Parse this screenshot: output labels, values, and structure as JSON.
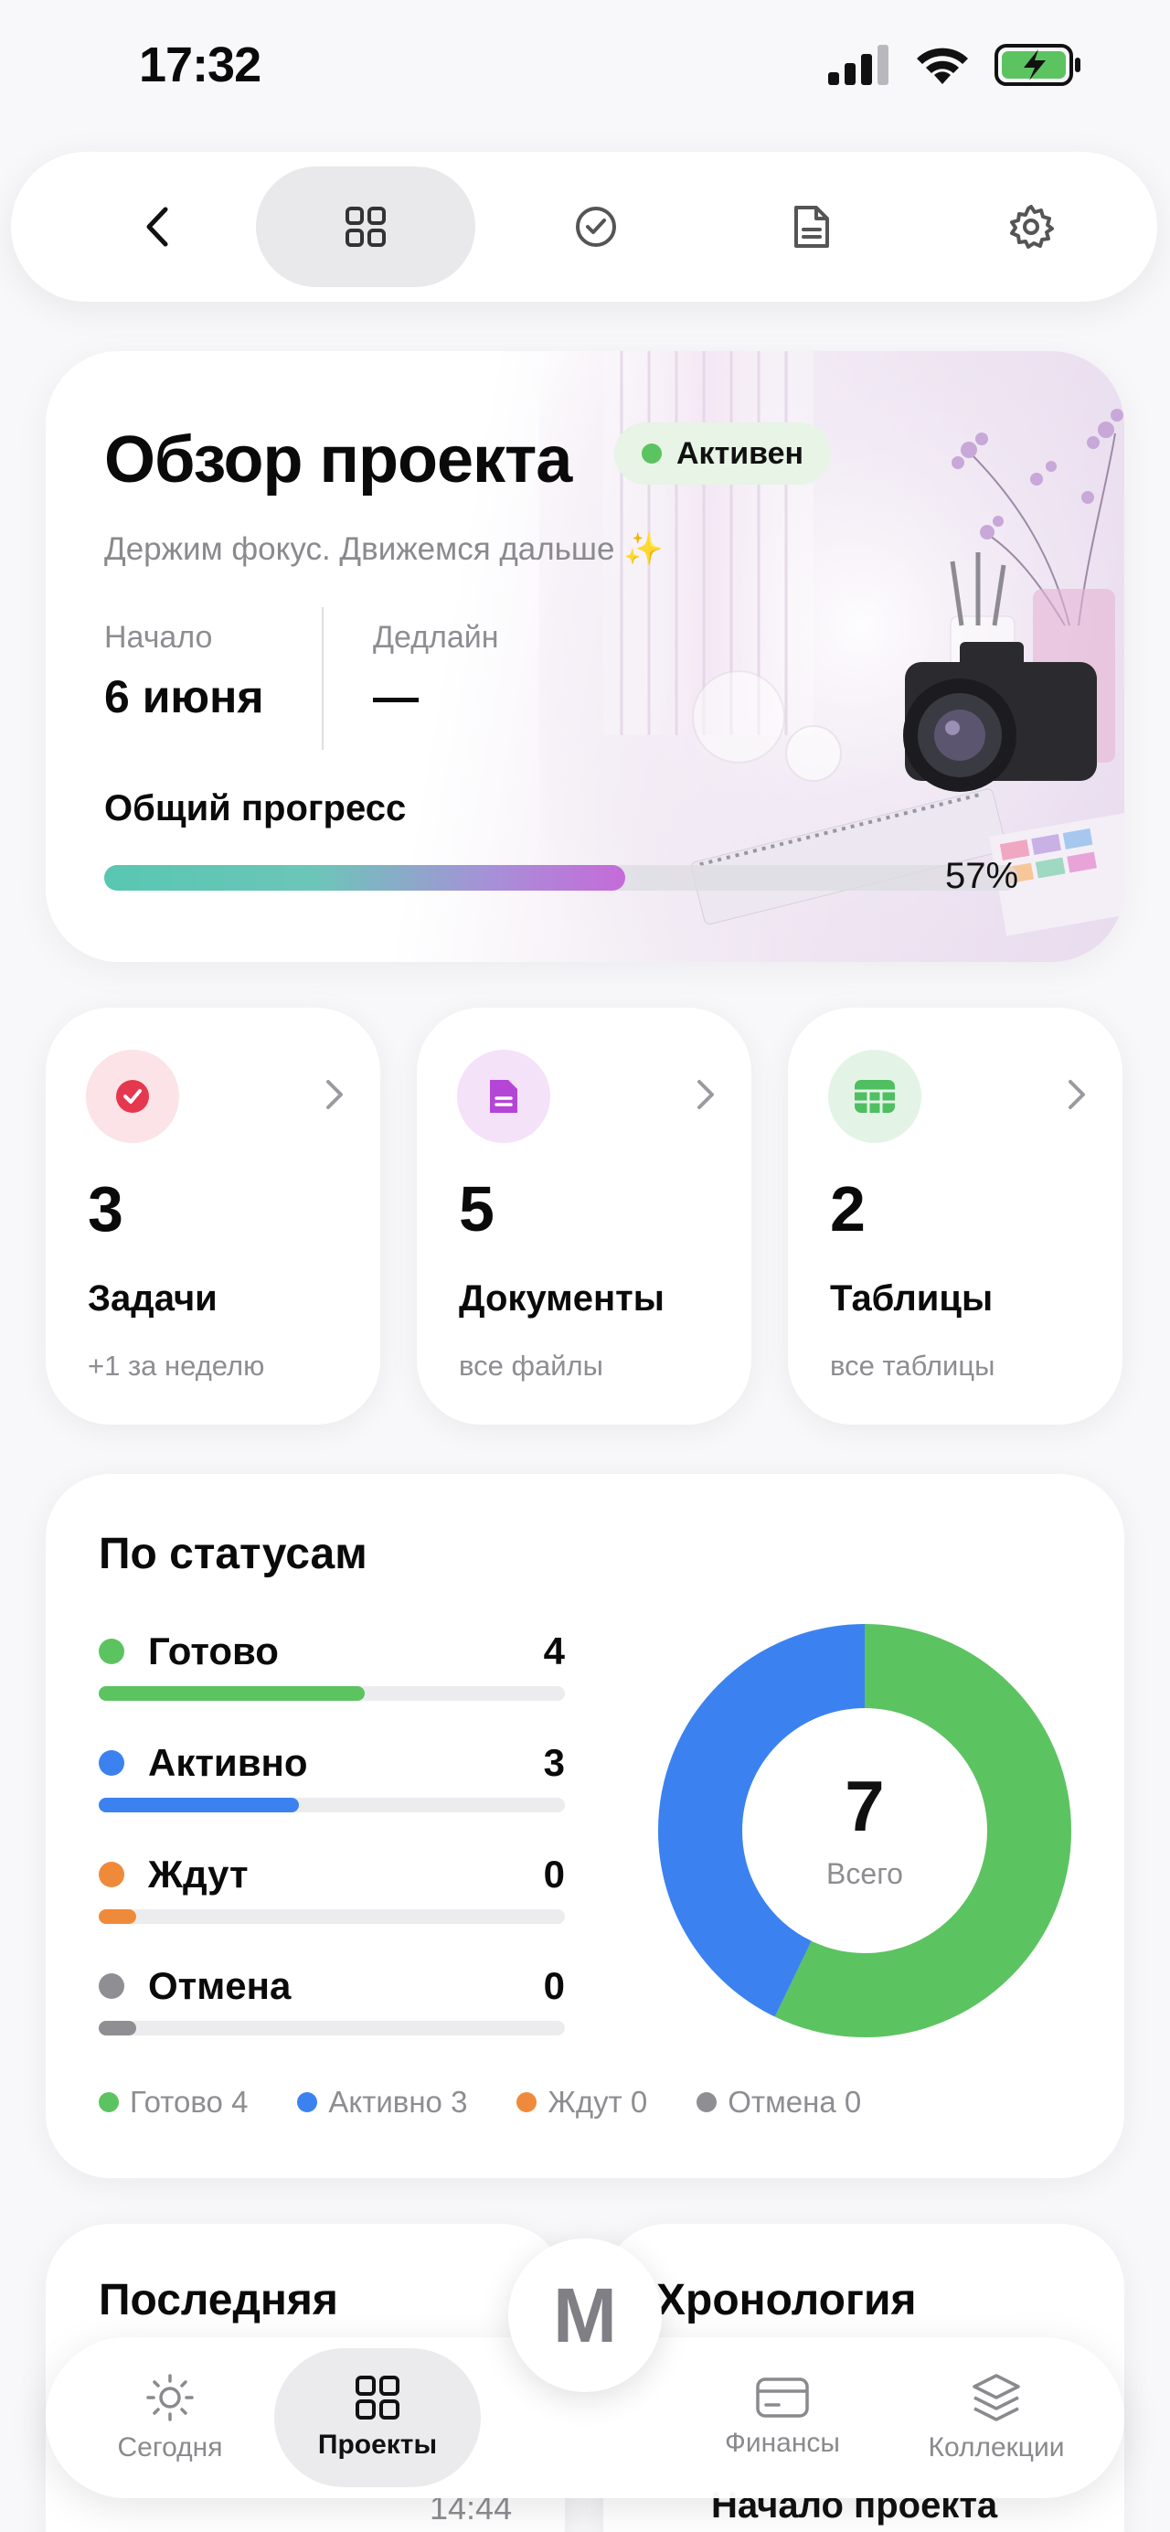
{
  "status_bar": {
    "time": "17:32"
  },
  "top_nav": {
    "tabs": [
      "back",
      "overview",
      "tasks",
      "documents",
      "settings"
    ],
    "active": "overview"
  },
  "hero": {
    "title": "Обзор проекта",
    "badge": "Активен",
    "subtitle": "Держим фокус. Движемся дальше ✨",
    "start_label": "Начало",
    "start_value": "6 июня",
    "deadline_label": "Дедлайн",
    "deadline_value": "—",
    "progress_label": "Общий прогресс",
    "progress_percent": 57,
    "progress_text": "57%"
  },
  "stats": [
    {
      "icon": "check-circle-icon",
      "count": "3",
      "label": "Задачи",
      "sub": "+1 за неделю",
      "color": "#e5384f"
    },
    {
      "icon": "document-icon",
      "count": "5",
      "label": "Документы",
      "sub": "все файлы",
      "color": "#b545d6"
    },
    {
      "icon": "table-icon",
      "count": "2",
      "label": "Таблицы",
      "sub": "все таблицы",
      "color": "#4fbf62"
    }
  ],
  "status_breakdown": {
    "title": "По статусам",
    "rows": [
      {
        "label": "Готово",
        "count": "4",
        "color": "#5cc361"
      },
      {
        "label": "Активно",
        "count": "3",
        "color": "#3b82f0"
      },
      {
        "label": "Ждут",
        "count": "0",
        "color": "#f08a3b"
      },
      {
        "label": "Отмена",
        "count": "0",
        "color": "#8e8e93"
      }
    ],
    "total": "7",
    "total_label": "Всего",
    "legend": [
      "Готово 4",
      "Активно 3",
      "Ждут 0",
      "Отмена 0"
    ]
  },
  "bottom_cards": {
    "left_title": "Последняя",
    "left_peek_time": "14:44",
    "right_title": "Хронология",
    "right_peek": "Начало проекта"
  },
  "tab_bar": {
    "items": [
      {
        "label": "Сегодня",
        "icon": "sun-icon"
      },
      {
        "label": "Проекты",
        "icon": "grid-icon"
      },
      {
        "label": "Финансы",
        "icon": "card-icon"
      },
      {
        "label": "Коллекции",
        "icon": "layers-icon"
      }
    ],
    "active": "Проекты",
    "fab_label": "M"
  }
}
